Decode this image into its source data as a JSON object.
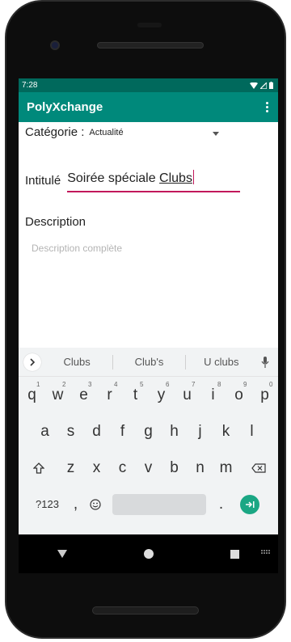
{
  "status_bar": {
    "time": "7:28"
  },
  "app_bar": {
    "title": "PolyXchange"
  },
  "form": {
    "category_label": "Catégorie :",
    "category_value": "Actualité",
    "title_label": "Intitulé",
    "title_value_prefix": "Soirée spéciale ",
    "title_value_composing": "Clubs",
    "description_label": "Description",
    "description_placeholder": "Description complète"
  },
  "keyboard": {
    "suggestions": [
      "Clubs",
      "Club's",
      "U clubs"
    ],
    "row1": [
      {
        "key": "q",
        "hint": "1"
      },
      {
        "key": "w",
        "hint": "2"
      },
      {
        "key": "e",
        "hint": "3"
      },
      {
        "key": "r",
        "hint": "4"
      },
      {
        "key": "t",
        "hint": "5"
      },
      {
        "key": "y",
        "hint": "6"
      },
      {
        "key": "u",
        "hint": "7"
      },
      {
        "key": "i",
        "hint": "8"
      },
      {
        "key": "o",
        "hint": "9"
      },
      {
        "key": "p",
        "hint": "0"
      }
    ],
    "row2": [
      "a",
      "s",
      "d",
      "f",
      "g",
      "h",
      "j",
      "k",
      "l"
    ],
    "row3": [
      "z",
      "x",
      "c",
      "v",
      "b",
      "n",
      "m"
    ],
    "symbols_label": "?123",
    "comma": ",",
    "period": "."
  },
  "colors": {
    "status_bar": "#00695c",
    "app_bar": "#00897b",
    "field_accent": "#c2185b",
    "enter_key": "#1ba784"
  }
}
